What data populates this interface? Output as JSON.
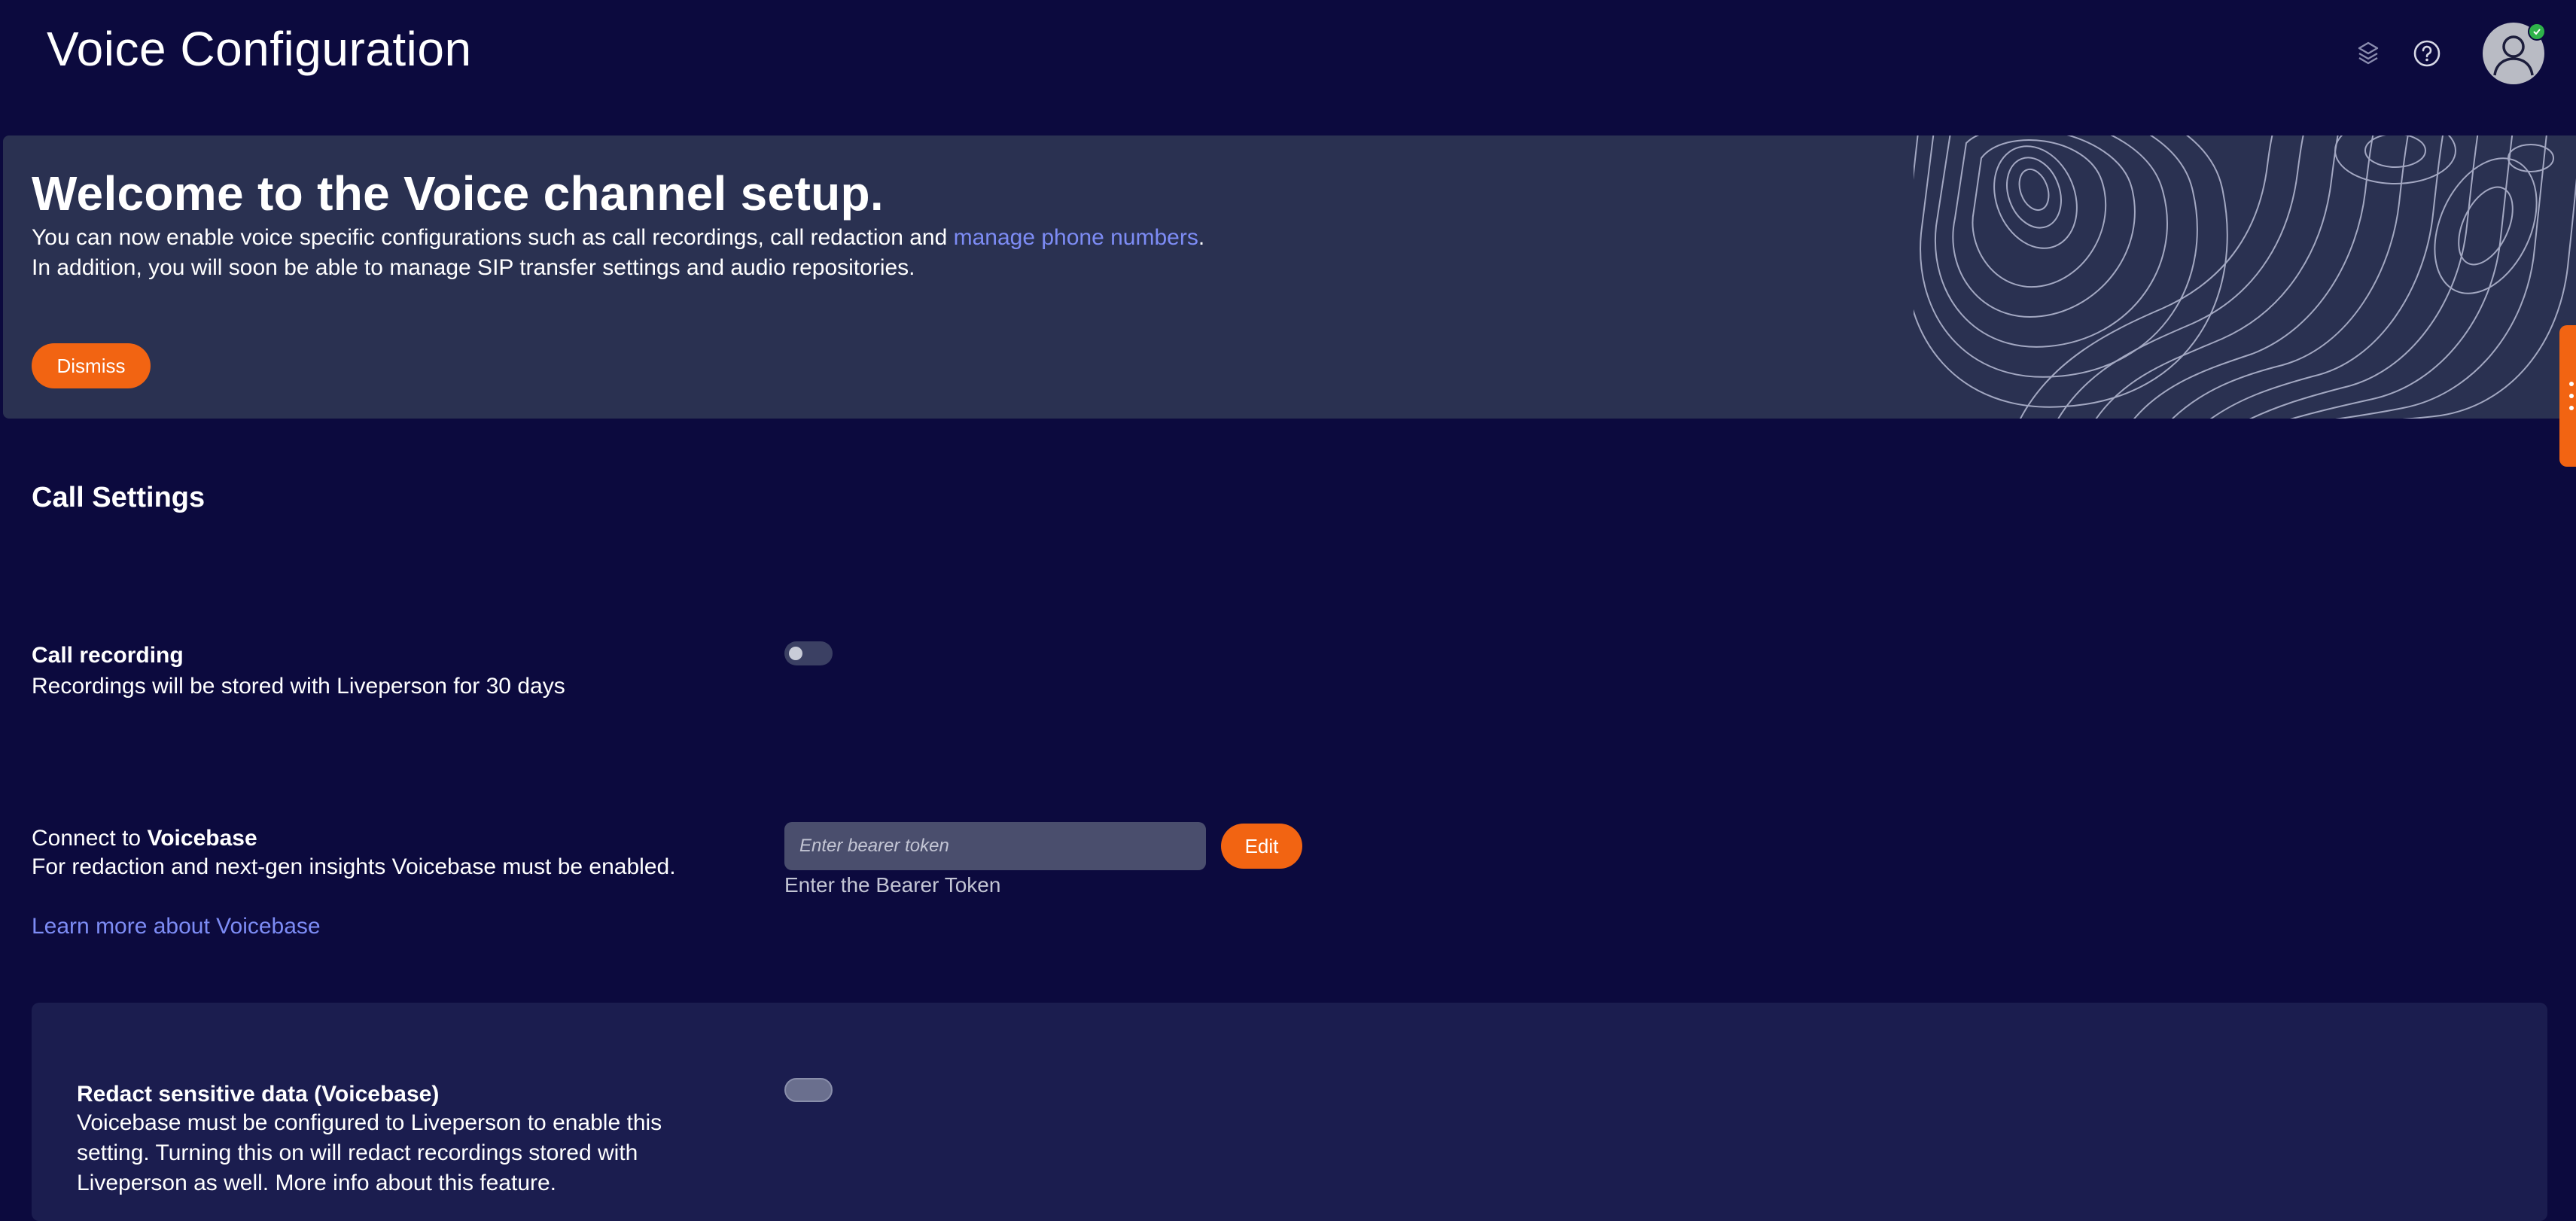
{
  "header": {
    "title": "Voice Configuration",
    "icons": [
      "layers-icon",
      "help-icon",
      "user-avatar-icon"
    ],
    "status_color": "#2fb34a"
  },
  "banner": {
    "title": "Welcome to the Voice channel setup.",
    "line1_prefix": "You can now enable voice specific configurations such as call recordings, call redaction and ",
    "line1_link": "manage phone numbers",
    "line1_suffix": ".",
    "line2": "In addition, you will soon be able to manage SIP transfer settings and audio repositories.",
    "dismiss_label": "Dismiss"
  },
  "call_settings": {
    "title": "Call Settings",
    "call_recording": {
      "label": "Call recording",
      "description": "Recordings will be stored with Liveperson for 30 days",
      "enabled": false
    },
    "voicebase": {
      "label_prefix": "Connect to ",
      "label_bold": "Voicebase",
      "description": "For redaction and next-gen insights Voicebase must be enabled.",
      "token_placeholder": "Enter bearer token",
      "token_value": "",
      "edit_label": "Edit",
      "helper": "Enter the Bearer Token",
      "learn_more": "Learn more about Voicebase"
    },
    "redact": {
      "label_prefix": "Redact sensitive data (",
      "label_bold": "Voicebase",
      "label_suffix": ")",
      "description_line1": "Voicebase must be configured to Liveperson to enable this",
      "description_line2": "setting. Turning this on will redact recordings stored with",
      "description_line3": "Liveperson as well. More info about this feature.",
      "enabled": false,
      "disabled": true
    }
  },
  "colors": {
    "background": "#0c0a3e",
    "banner": "#2a3151",
    "accent": "#f26412",
    "link": "#7d8cf5"
  }
}
